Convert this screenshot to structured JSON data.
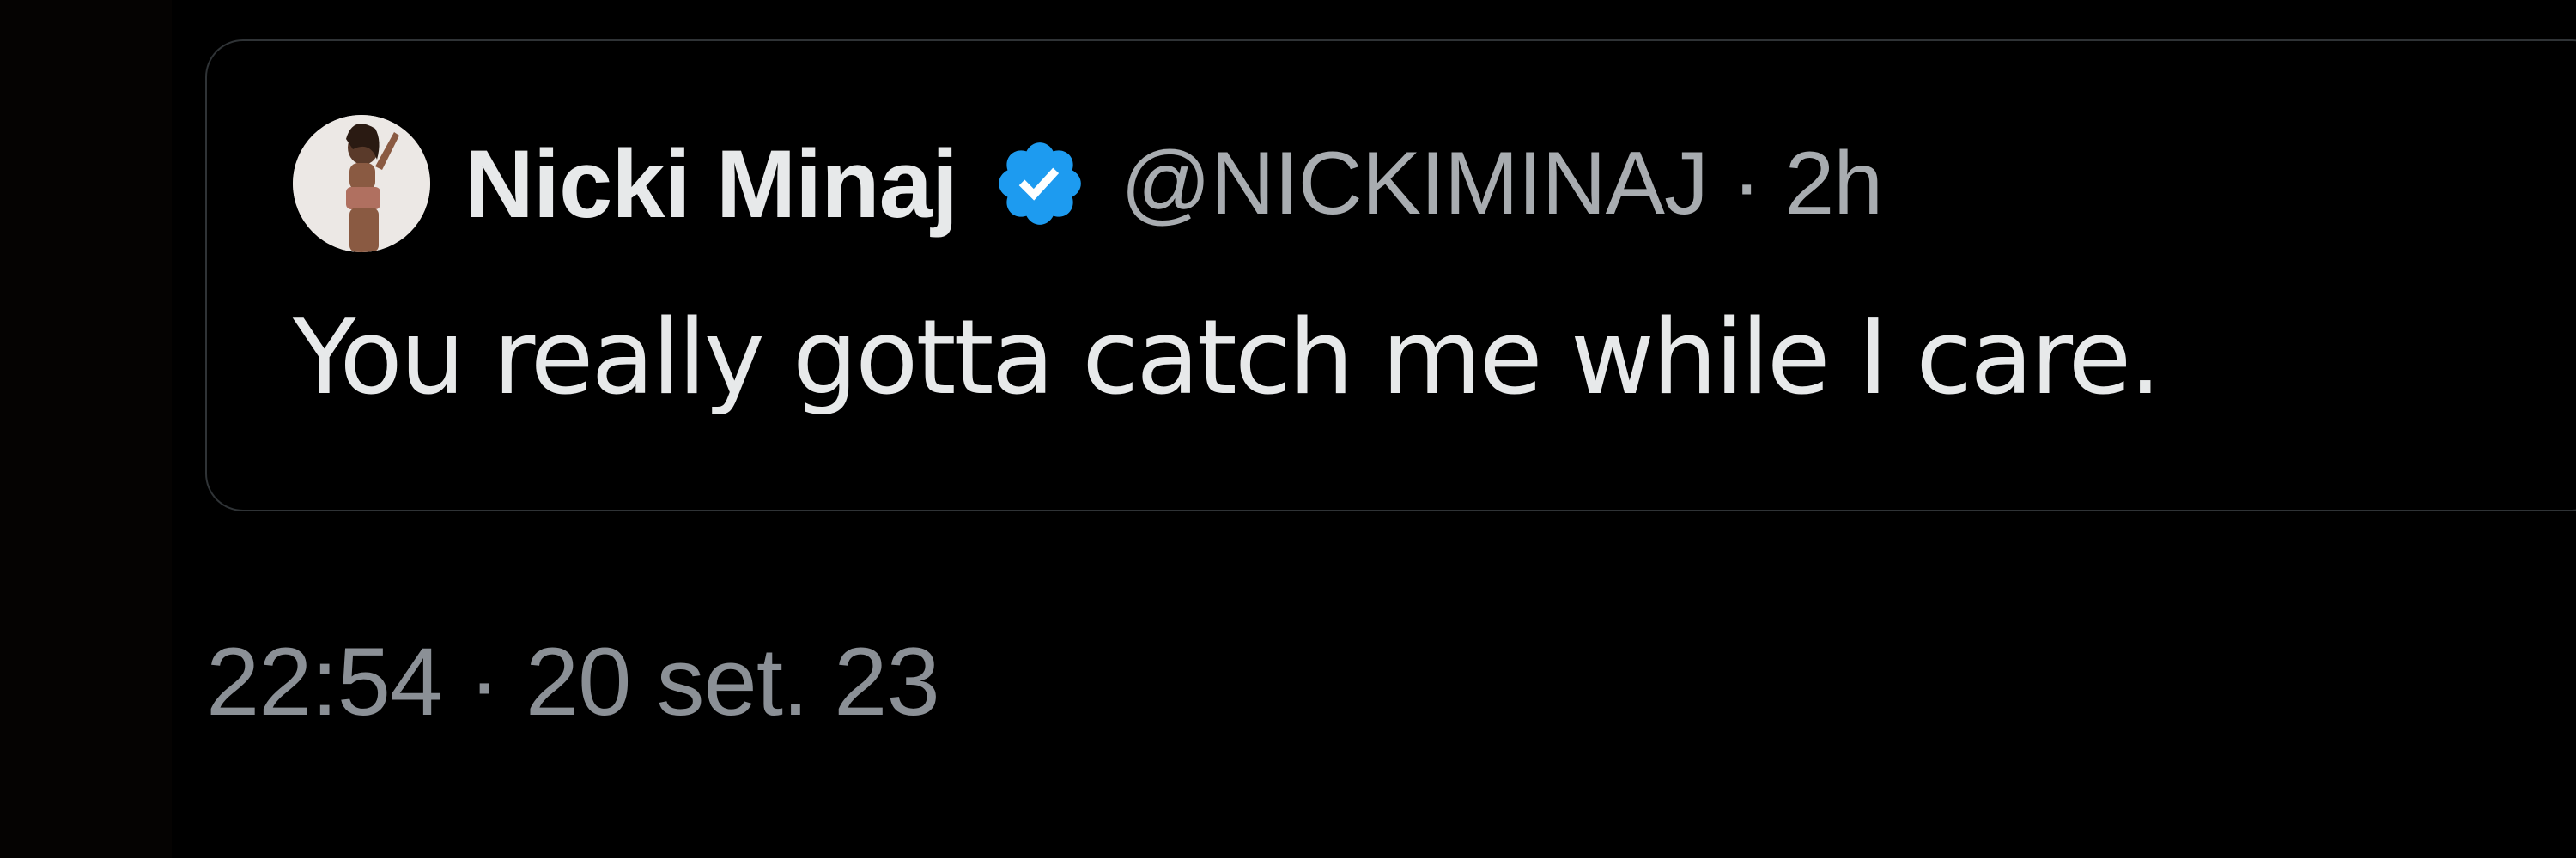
{
  "quoted_tweet": {
    "author": {
      "display_name": "Nicki Minaj",
      "verified": true,
      "avatar_icon": "profile-photo",
      "verified_icon": "verified-badge-icon"
    },
    "handle": "@NICKIMINAJ",
    "separator": "·",
    "relative_time": "2h",
    "text": "You really gotta catch me while I care."
  },
  "tweet_meta": {
    "time": "22:54",
    "separator": "·",
    "date": "20 set. 23"
  },
  "colors": {
    "background": "#000000",
    "card_border": "#2f3336",
    "primary_text": "#e7e9ea",
    "secondary_text": "#8b9096",
    "verified_blue": "#1d9bf0"
  }
}
